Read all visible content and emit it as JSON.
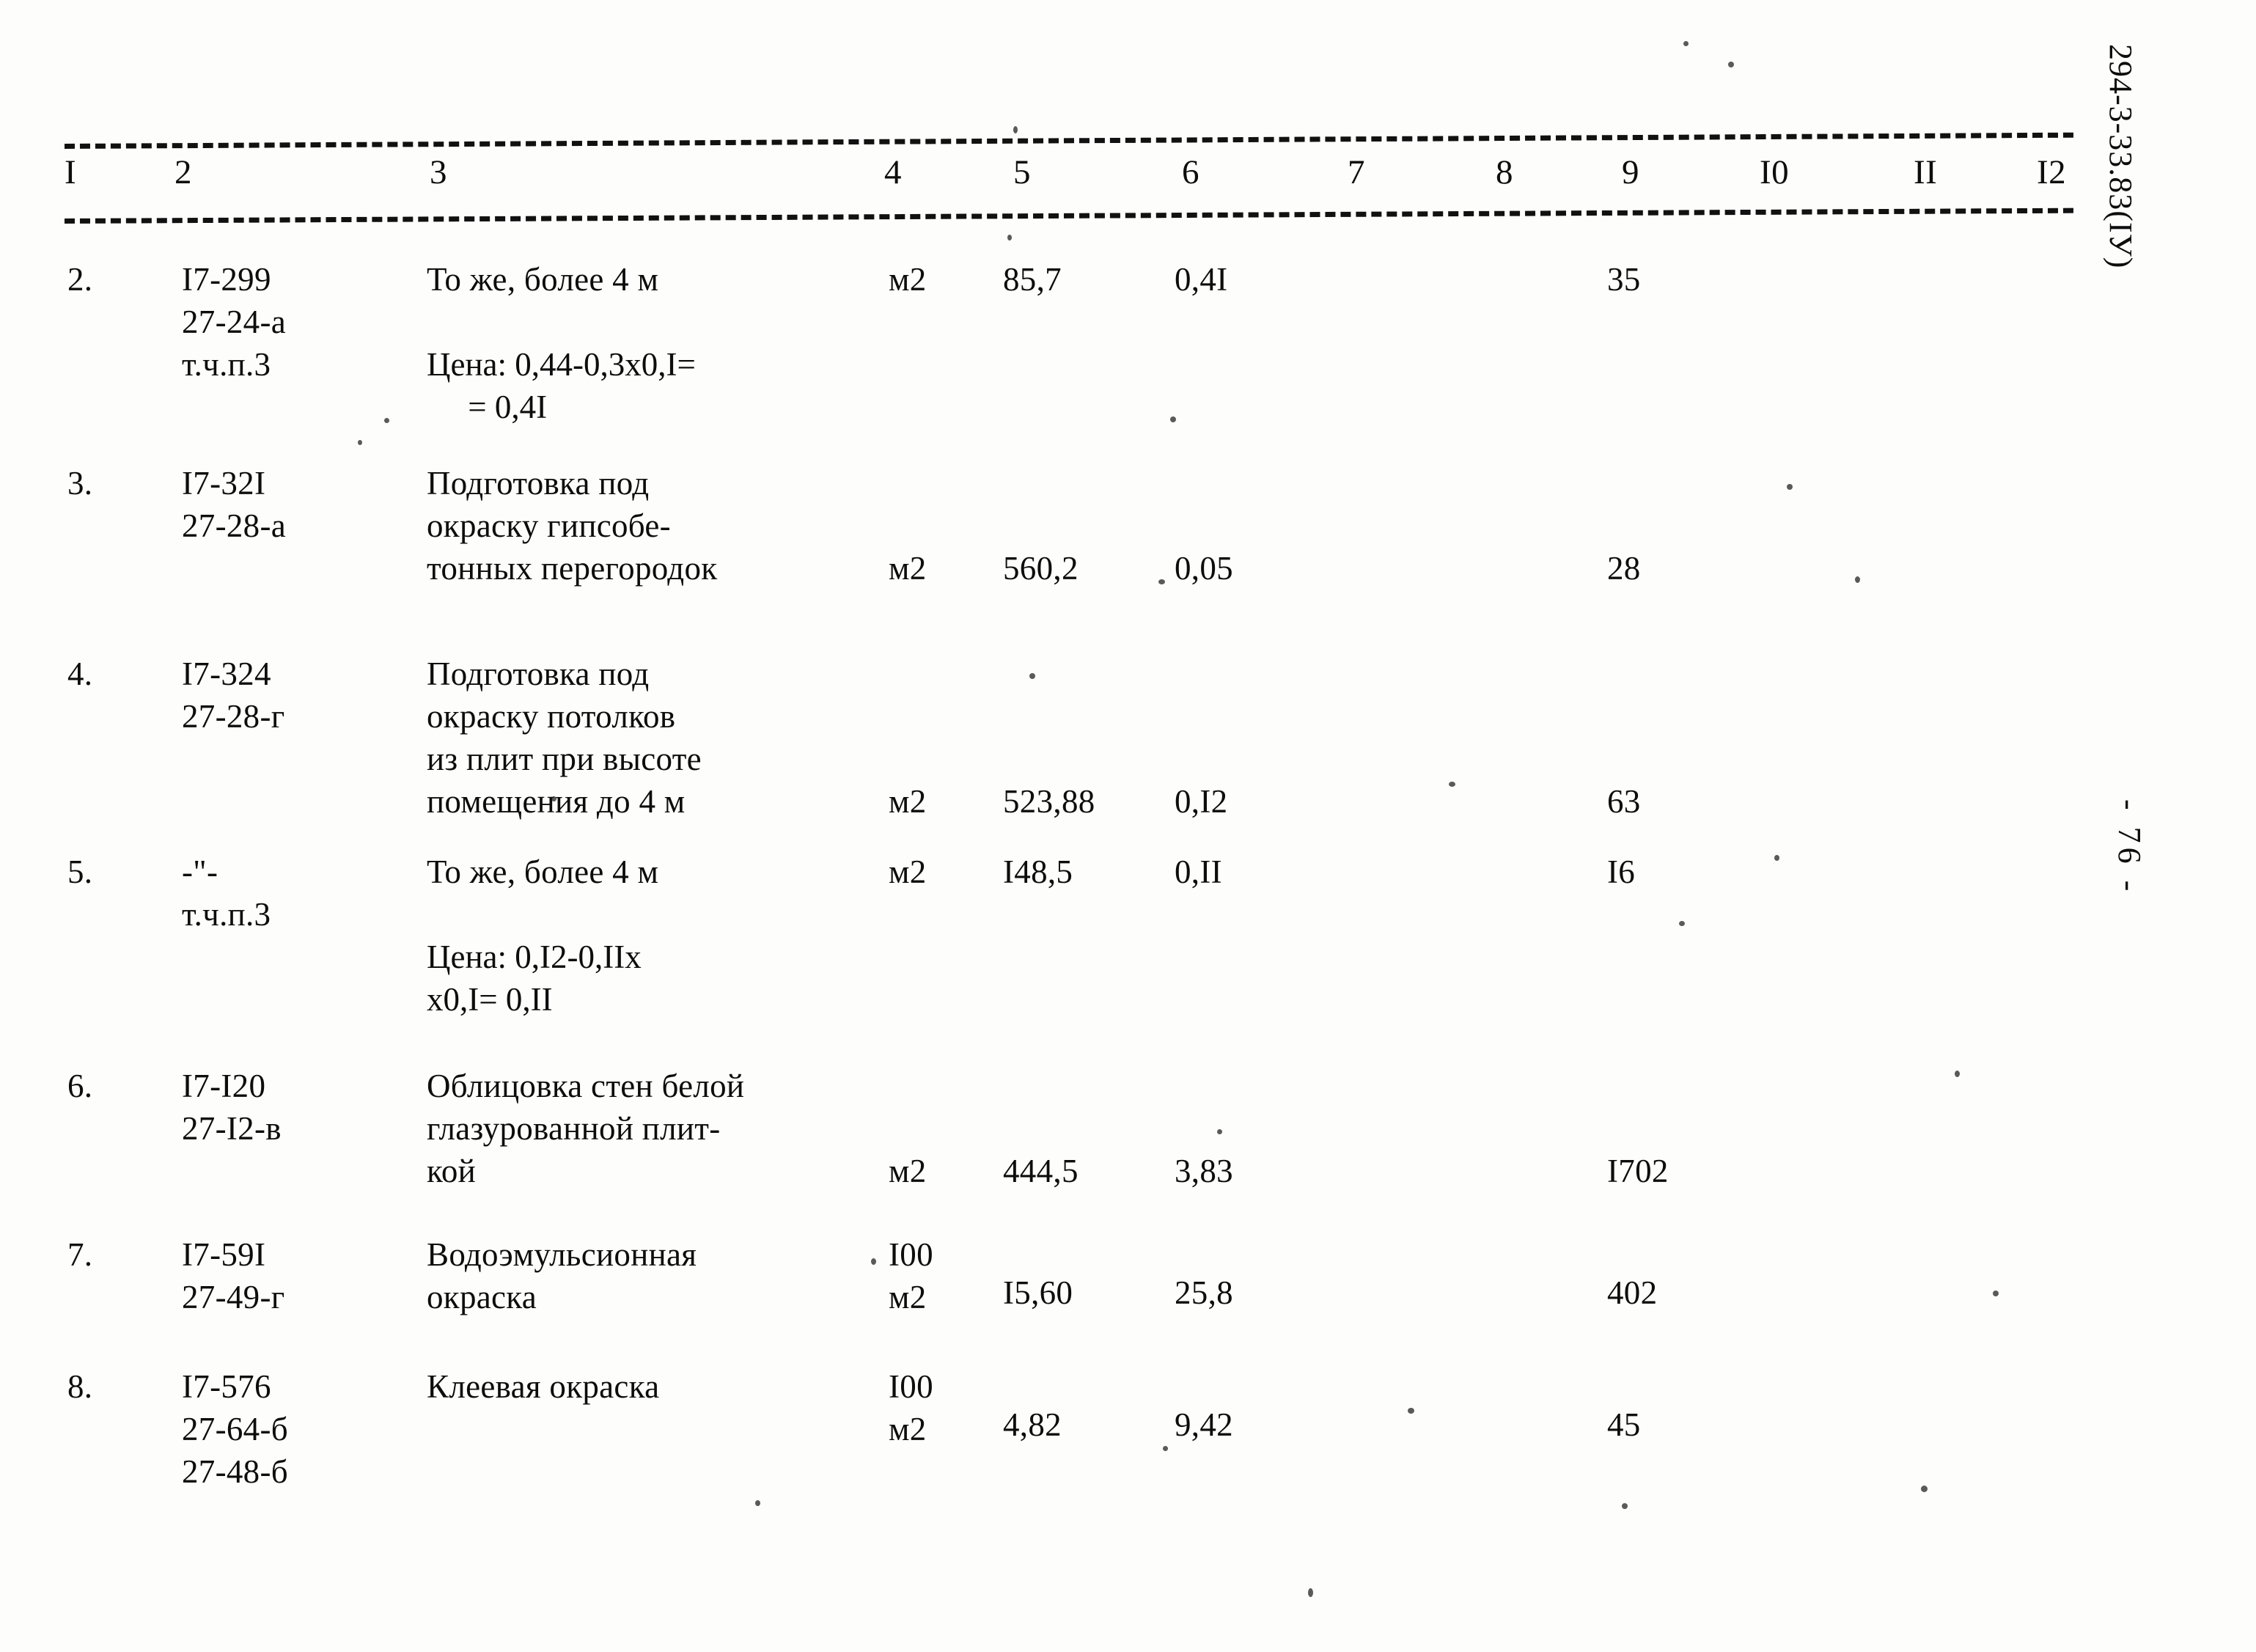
{
  "document": {
    "margin_code": "294-3-33.83(IУ)",
    "page_marker": "- 76 -"
  },
  "table": {
    "column_headers": [
      "I",
      "2",
      "3",
      "4",
      "5",
      "6",
      "7",
      "8",
      "9",
      "I0",
      "II",
      "I2"
    ],
    "rows": [
      {
        "no": "2.",
        "code": "I7-299\n27-24-а\nт.ч.п.3",
        "desc": "То же, более 4 м",
        "note": "Цена: 0,44-0,3х0,I=\n     = 0,4I",
        "unit": "м2",
        "qty": "85,7",
        "price": "0,4I",
        "col7": "",
        "col8": "",
        "col9": "35",
        "col10": "",
        "col11": "",
        "col12": ""
      },
      {
        "no": "3.",
        "code": "I7-32I\n27-28-а",
        "desc": "Подготовка под\nокраску гипсобе-\nтонных перегородок",
        "note": "",
        "unit": "м2",
        "qty": "560,2",
        "price": "0,05",
        "col7": "",
        "col8": "",
        "col9": "28",
        "col10": "",
        "col11": "",
        "col12": ""
      },
      {
        "no": "4.",
        "code": "I7-324\n27-28-г",
        "desc": "Подготовка под\nокраску потолков\nиз плит при высоте\nпомещения до 4 м",
        "note": "",
        "unit": "м2",
        "qty": "523,88",
        "price": "0,I2",
        "col7": "",
        "col8": "",
        "col9": "63",
        "col10": "",
        "col11": "",
        "col12": ""
      },
      {
        "no": "5.",
        "code": "-\"-\nт.ч.п.3",
        "desc": "То же, более 4 м",
        "note": "Цена: 0,I2-0,IIх\nх0,I= 0,II",
        "unit": "м2",
        "qty": "I48,5",
        "price": "0,II",
        "col7": "",
        "col8": "",
        "col9": "I6",
        "col10": "",
        "col11": "",
        "col12": ""
      },
      {
        "no": "6.",
        "code": "I7-I20\n27-I2-в",
        "desc": "Облицовка стен белой\nглазурованной плит-\nкой",
        "note": "",
        "unit": "м2",
        "qty": "444,5",
        "price": "3,83",
        "col7": "",
        "col8": "",
        "col9": "I702",
        "col10": "",
        "col11": "",
        "col12": ""
      },
      {
        "no": "7.",
        "code": "I7-59I\n27-49-г",
        "desc": "Водоэмульсионная\nокраска",
        "note": "",
        "unit": "I00\nм2",
        "qty": "I5,60",
        "price": "25,8",
        "col7": "",
        "col8": "",
        "col9": "402",
        "col10": "",
        "col11": "",
        "col12": ""
      },
      {
        "no": "8.",
        "code": "I7-576\n27-64-б\n27-48-б",
        "desc": "Клеевая окраска",
        "note": "",
        "unit": "I00\nм2",
        "qty": "4,82",
        "price": "9,42",
        "col7": "",
        "col8": "",
        "col9": "45",
        "col10": "",
        "col11": "",
        "col12": ""
      }
    ]
  }
}
